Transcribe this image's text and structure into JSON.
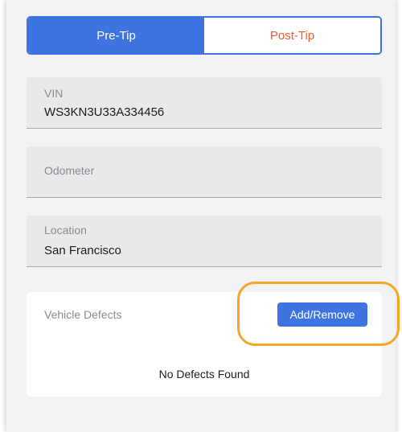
{
  "tabs": {
    "pre_tip": "Pre-Tip",
    "post_tip": "Post-Tip",
    "active": "pre_tip"
  },
  "fields": {
    "vin": {
      "label": "VIN",
      "value": "WS3KN3U33A334456"
    },
    "odometer": {
      "label": "Odometer",
      "value": ""
    },
    "location": {
      "label": "Location",
      "value": "San Francisco"
    }
  },
  "defects": {
    "title": "Vehicle Defects",
    "button_label": "Add/Remove",
    "empty_message": "No Defects Found"
  },
  "colors": {
    "accent": "#3f74e0",
    "inactive_tab_text": "#f15a2b",
    "highlight": "#f5a623"
  }
}
